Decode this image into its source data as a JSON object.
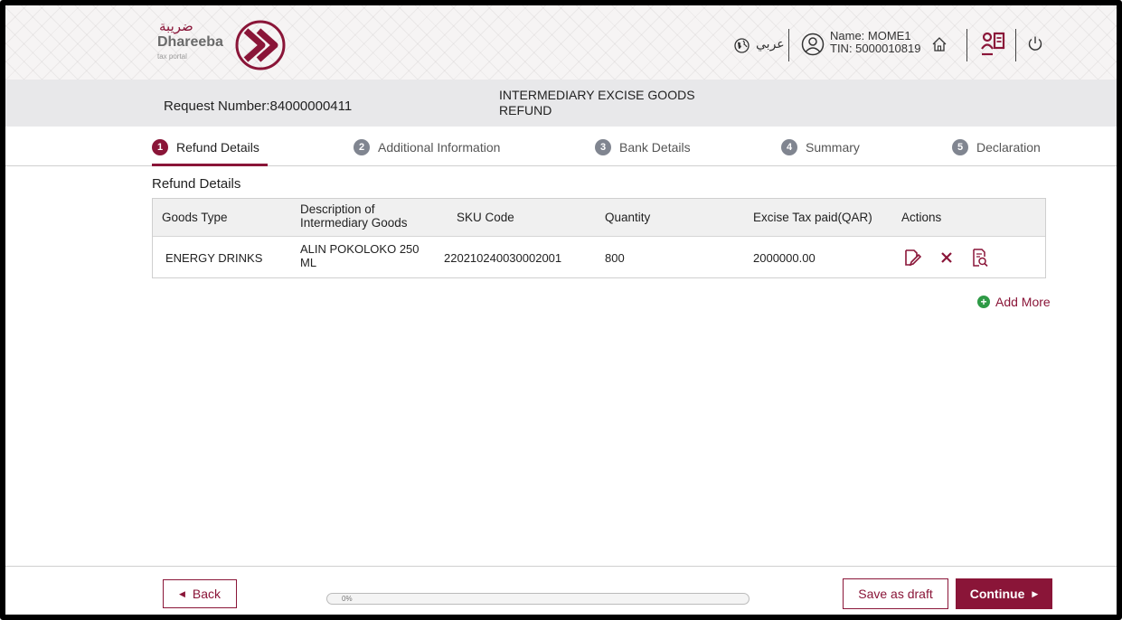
{
  "colors": {
    "brand": "#8a1538",
    "add": "#2e9a46",
    "step_inactive": "#808590"
  },
  "header": {
    "logo": {
      "arabic": "ضريبة",
      "name": "Dhareeba",
      "tagline": "tax portal"
    },
    "language_label": "عربي",
    "user": {
      "name": "Name: MOME1",
      "tin": "TIN: 5000010819"
    },
    "icons": [
      "globe-icon",
      "user-icon",
      "home-icon",
      "reports-icon",
      "power-icon"
    ]
  },
  "request": {
    "number": "Request Number:84000000411",
    "title": "INTERMEDIARY EXCISE GOODS REFUND"
  },
  "steps": [
    {
      "num": "1",
      "label": "Refund Details",
      "active": true
    },
    {
      "num": "2",
      "label": "Additional Information",
      "active": false
    },
    {
      "num": "3",
      "label": "Bank Details",
      "active": false
    },
    {
      "num": "4",
      "label": "Summary",
      "active": false
    },
    {
      "num": "5",
      "label": "Declaration",
      "active": false
    }
  ],
  "section": {
    "title": "Refund Details",
    "table": {
      "columns": [
        "Goods Type",
        "Description of Intermediary Goods",
        "SKU Code",
        "Quantity",
        "Excise Tax paid(QAR)",
        "Actions"
      ],
      "rows": [
        {
          "goods_type": "ENERGY DRINKS",
          "description": "ALIN POKOLOKO 250 ML",
          "sku": "220210240030002001",
          "quantity": "800",
          "tax": "2000000.00",
          "actions": [
            "edit-icon",
            "delete-icon",
            "view-icon"
          ]
        }
      ]
    },
    "add_more": "Add More"
  },
  "footer": {
    "back": "Back",
    "progress_value": 0,
    "progress_text": "0%",
    "save_draft": "Save as draft",
    "continue": "Continue"
  }
}
